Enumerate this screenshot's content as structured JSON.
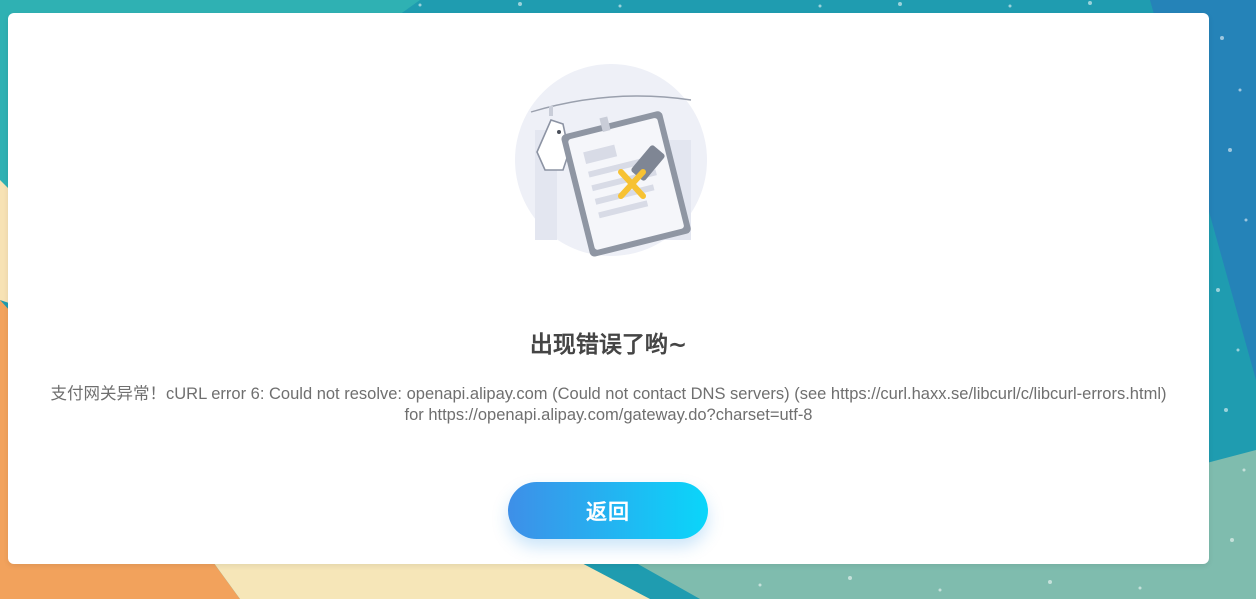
{
  "error": {
    "title": "出现错误了哟~",
    "message_line1": "支付网关异常！cURL error 6: Could not resolve: openapi.alipay.com (Could not contact DNS servers) (see https://curl.haxx.se/libcurl/c/libcurl-errors.html)",
    "message_line2": "for https://openapi.alipay.com/gateway.do?charset=utf-8"
  },
  "actions": {
    "back_label": "返回"
  },
  "illustration": {
    "icon": "error-document-illustration"
  },
  "colors": {
    "background_teal": "#1f9cb0",
    "background_orange": "#f2a25c",
    "background_cream": "#f6e6b8",
    "button_gradient_start": "#3e8fe8",
    "button_gradient_end": "#0ad6fa",
    "error_mark": "#f7c233"
  }
}
